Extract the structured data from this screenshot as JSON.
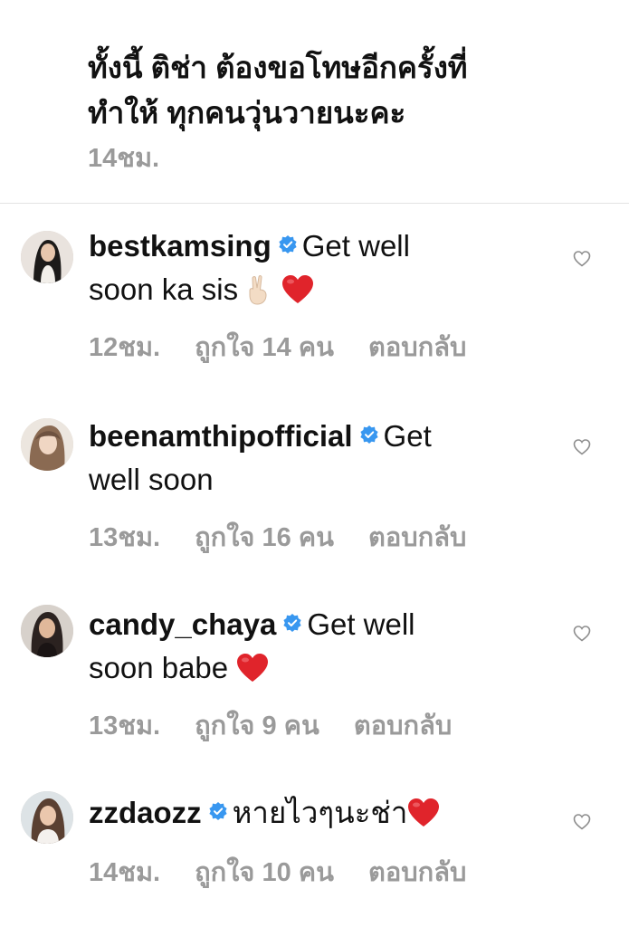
{
  "post": {
    "caption": "ทั้งนี้ ติช่า ต้องขอโทษอีกครั้งที่ทำให้ ทุกคนวุ่นวายนะคะ",
    "caption_line1": "ทั้งนี้ ติช่า ต้องขอโทษอีกครั้งที่",
    "caption_line2": "ทำให้ ทุกคนวุ่นวายนะคะ",
    "time": "14ชม."
  },
  "colors": {
    "text": "#111111",
    "meta": "#9a9a9a",
    "verified": "#3897f0",
    "divider": "#e3e3e3"
  },
  "comments": [
    {
      "username": "bestkamsing",
      "verified": true,
      "text_line1": "Get well",
      "text_line2": "soon ka sis",
      "emojis": [
        "victory-hand",
        "red-heart"
      ],
      "time": "12ชม.",
      "likes": "ถูกใจ 14 คน",
      "reply": "ตอบกลับ"
    },
    {
      "username": "beenamthipofficial",
      "verified": true,
      "text_line1": "Get",
      "text_line2": "well soon",
      "emojis": [],
      "time": "13ชม.",
      "likes": "ถูกใจ 16 คน",
      "reply": "ตอบกลับ"
    },
    {
      "username": "candy_chaya",
      "verified": true,
      "text_line1": "Get well",
      "text_line2": "soon babe",
      "emojis": [
        "red-heart"
      ],
      "time": "13ชม.",
      "likes": "ถูกใจ 9 คน",
      "reply": "ตอบกลับ"
    },
    {
      "username": "zzdaozz",
      "verified": true,
      "text_line1": "หายไวๆนะช่า",
      "emojis": [
        "red-heart"
      ],
      "time": "14ชม.",
      "likes": "ถูกใจ 10 คน",
      "reply": "ตอบกลับ"
    }
  ]
}
